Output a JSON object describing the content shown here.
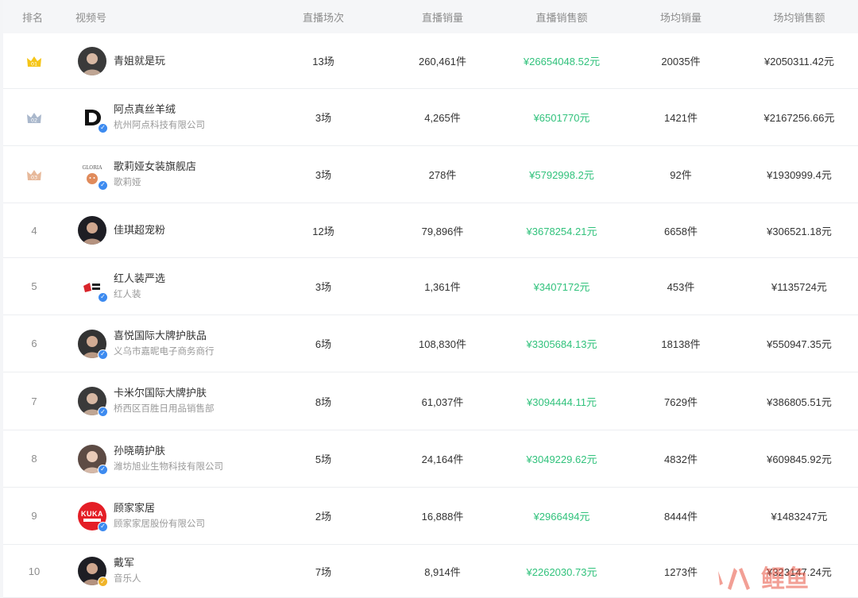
{
  "header": {
    "rank": "排名",
    "account": "视频号",
    "sessions": "直播场次",
    "sales": "直播销量",
    "revenue": "直播销售额",
    "avg_sales": "场均销量",
    "avg_revenue": "场均销售额"
  },
  "rows": [
    {
      "rank": "01",
      "medal": "gold",
      "name": "青姐就是玩",
      "sub": "",
      "sessions": "13场",
      "sales": "260,461件",
      "revenue": "¥26654048.52元",
      "avg_sales": "20035件",
      "avg_revenue": "¥2050311.42元",
      "avatar_icon": "person-avatar-icon",
      "verified": false
    },
    {
      "rank": "02",
      "medal": "silver",
      "name": "阿点真丝羊绒",
      "sub": "杭州阿点科技有限公司",
      "sessions": "3场",
      "sales": "4,265件",
      "revenue": "¥6501770元",
      "avg_sales": "1421件",
      "avg_revenue": "¥2167256.66元",
      "avatar_icon": "d-logo-icon",
      "verified": true
    },
    {
      "rank": "03",
      "medal": "bronze",
      "name": "歌莉娅女装旗舰店",
      "sub": "歌莉娅",
      "sessions": "3场",
      "sales": "278件",
      "revenue": "¥5792998.2元",
      "avg_sales": "92件",
      "avg_revenue": "¥1930999.4元",
      "avatar_icon": "gloria-logo-icon",
      "verified": true
    },
    {
      "rank": "4",
      "medal": "",
      "name": "佳琪超宠粉",
      "sub": "",
      "sessions": "12场",
      "sales": "79,896件",
      "revenue": "¥3678254.21元",
      "avg_sales": "6658件",
      "avg_revenue": "¥306521.18元",
      "avatar_icon": "person-avatar-icon",
      "verified": false
    },
    {
      "rank": "5",
      "medal": "",
      "name": "红人装严选",
      "sub": "红人装",
      "sessions": "3场",
      "sales": "1,361件",
      "revenue": "¥3407172元",
      "avg_sales": "453件",
      "avg_revenue": "¥1135724元",
      "avatar_icon": "hongrenzhuang-logo-icon",
      "verified": true
    },
    {
      "rank": "6",
      "medal": "",
      "name": "喜悦国际大牌护肤品",
      "sub": "义乌市嘉昵电子商务商行",
      "sessions": "6场",
      "sales": "108,830件",
      "revenue": "¥3305684.13元",
      "avg_sales": "18138件",
      "avg_revenue": "¥550947.35元",
      "avatar_icon": "person-avatar-icon",
      "verified": true
    },
    {
      "rank": "7",
      "medal": "",
      "name": "卡米尔国际大牌护肤",
      "sub": "桥西区百胜日用品销售部",
      "sessions": "8场",
      "sales": "61,037件",
      "revenue": "¥3094444.11元",
      "avg_sales": "7629件",
      "avg_revenue": "¥386805.51元",
      "avatar_icon": "person-avatar-icon",
      "verified": true
    },
    {
      "rank": "8",
      "medal": "",
      "name": "孙晓萌护肤",
      "sub": "潍坊旭业生物科技有限公司",
      "sessions": "5场",
      "sales": "24,164件",
      "revenue": "¥3049229.62元",
      "avg_sales": "4832件",
      "avg_revenue": "¥609845.92元",
      "avatar_icon": "person-avatar-icon",
      "verified": true
    },
    {
      "rank": "9",
      "medal": "",
      "name": "顾家家居",
      "sub": "顾家家居股份有限公司",
      "sessions": "2场",
      "sales": "16,888件",
      "revenue": "¥2966494元",
      "avg_sales": "8444件",
      "avg_revenue": "¥1483247元",
      "avatar_icon": "kuka-logo-icon",
      "verified": true
    },
    {
      "rank": "10",
      "medal": "",
      "name": "戴军",
      "sub": "音乐人",
      "sessions": "7场",
      "sales": "8,914件",
      "revenue": "¥2262030.73元",
      "avg_sales": "1273件",
      "avg_revenue": "¥323147.24元",
      "avatar_icon": "person-avatar-icon",
      "verified": true,
      "verified_color": "gold"
    }
  ],
  "kuka_logo_text": "KUKA",
  "watermark": "火鲤鱼",
  "colors": {
    "revenue_green": "#31c27c",
    "verified_blue": "#3d8bf0",
    "gold": "#f5c518",
    "silver": "#aab8cc",
    "bronze": "#e7b99b"
  }
}
